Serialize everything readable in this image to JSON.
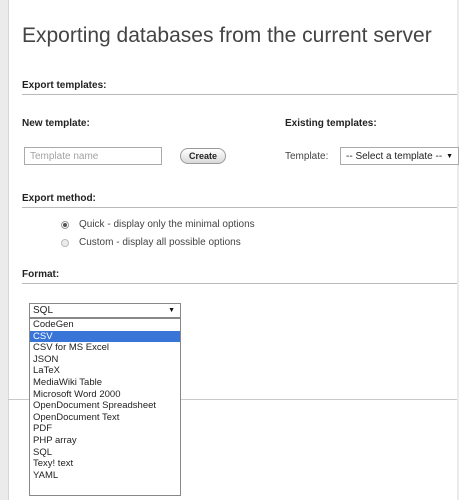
{
  "page": {
    "title": "Exporting databases from the current server"
  },
  "templates": {
    "section_title": "Export templates:",
    "new_heading": "New template:",
    "existing_heading": "Existing templates:",
    "name_placeholder": "Template name",
    "create_button": "Create",
    "template_label": "Template:",
    "template_select_value": "-- Select a template --"
  },
  "export_method": {
    "section_title": "Export method:",
    "options": [
      {
        "label": "Quick - display only the minimal options",
        "checked": true
      },
      {
        "label": "Custom - display all possible options",
        "checked": false
      }
    ]
  },
  "format": {
    "section_title": "Format:",
    "selected": "SQL",
    "highlighted": "CSV",
    "options": [
      "CodeGen",
      "CSV",
      "CSV for MS Excel",
      "JSON",
      "LaTeX",
      "MediaWiki Table",
      "Microsoft Word 2000",
      "OpenDocument Spreadsheet",
      "OpenDocument Text",
      "PDF",
      "PHP array",
      "SQL",
      "Texy! text",
      "YAML"
    ]
  },
  "colors": {
    "highlight": "#3875d7",
    "rule": "#b9b9b9"
  }
}
